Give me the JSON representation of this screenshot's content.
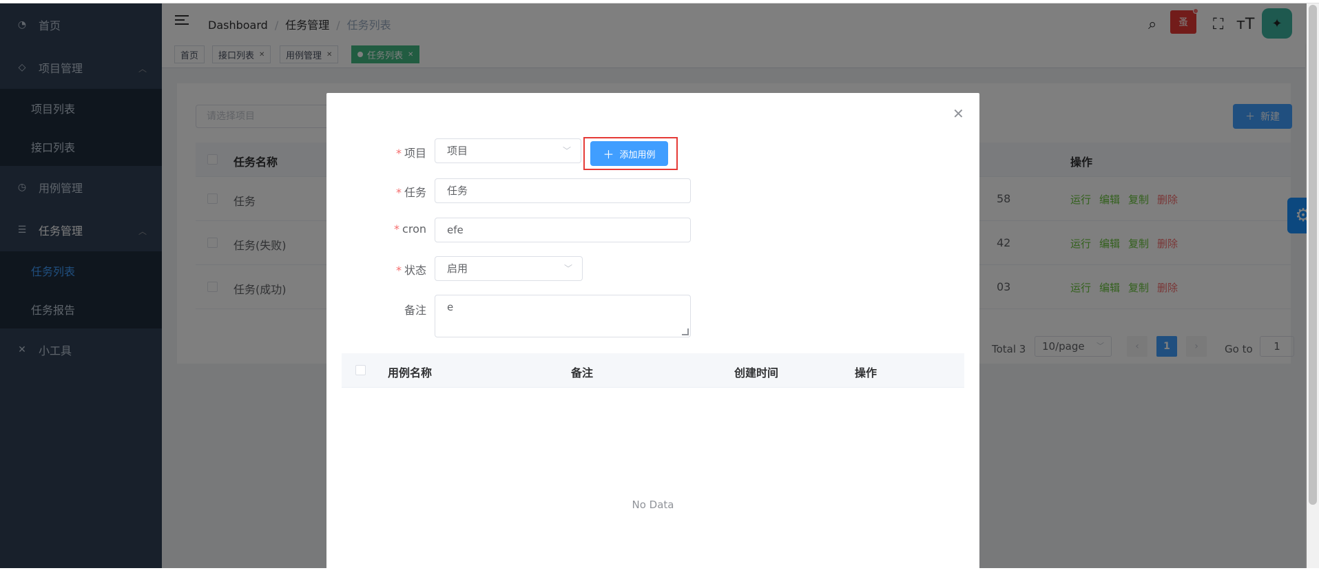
{
  "sidebar": {
    "items": [
      {
        "label": "首页",
        "icon": "dashboard-icon"
      },
      {
        "label": "项目管理",
        "icon": "layers-icon",
        "children": [
          "项目列表",
          "接口列表"
        ]
      },
      {
        "label": "用例管理",
        "icon": "clock-icon"
      },
      {
        "label": "任务管理",
        "icon": "list-icon",
        "children": [
          "任务列表",
          "任务报告"
        ]
      },
      {
        "label": "小工具",
        "icon": "tools-icon"
      }
    ],
    "active_child": "任务列表"
  },
  "header": {
    "breadcrumb": [
      "Dashboard",
      "任务管理",
      "任务列表"
    ],
    "bug_label": "蚤"
  },
  "tags": [
    {
      "label": "首页"
    },
    {
      "label": "接口列表"
    },
    {
      "label": "用例管理"
    },
    {
      "label": "任务列表",
      "active": true
    }
  ],
  "main": {
    "project_placeholder": "请选择项目",
    "new_button": "新建",
    "columns": {
      "name": "任务名称",
      "ops": "操作"
    },
    "rows": [
      {
        "name": "任务",
        "tail": "58"
      },
      {
        "name": "任务(失败)",
        "tail": "42"
      },
      {
        "name": "任务(成功)",
        "tail": "03"
      }
    ],
    "ops": {
      "run": "运行",
      "edit": "编辑",
      "copy": "复制",
      "delete": "删除"
    },
    "pagination": {
      "total": "Total 3",
      "page_size": "10/page",
      "current": "1",
      "goto_label": "Go to",
      "goto_value": "1"
    }
  },
  "dialog": {
    "fields": {
      "project": {
        "label": "项目",
        "value": "项目"
      },
      "task": {
        "label": "任务",
        "value": "任务"
      },
      "cron": {
        "label": "cron",
        "value": "efe"
      },
      "status": {
        "label": "状态",
        "value": "启用"
      },
      "remark": {
        "label": "备注",
        "value": "e"
      }
    },
    "add_case_button": "添加用例",
    "case_columns": {
      "name": "用例名称",
      "remark": "备注",
      "created": "创建时间",
      "ops": "操作"
    },
    "empty_text": "No Data"
  },
  "colors": {
    "primary": "#409eff",
    "sidebar_bg": "#304156",
    "active_tag": "#42b983",
    "danger": "#f56c6c",
    "success": "#67c23a",
    "highlight_border": "#e53935"
  }
}
